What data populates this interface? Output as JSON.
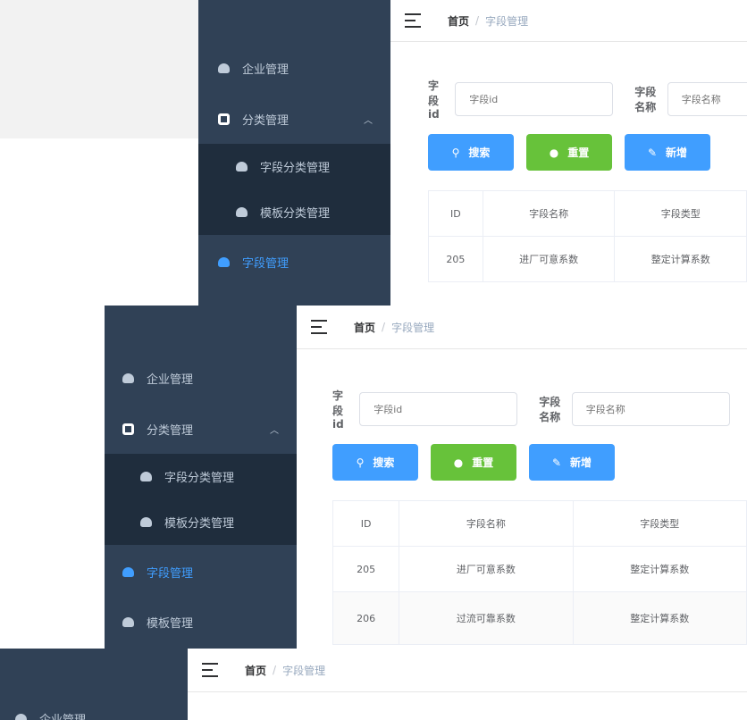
{
  "sidebar": {
    "items": [
      {
        "label": "企业管理",
        "icon": "cloud-icon"
      },
      {
        "label": "分类管理",
        "icon": "square-ring-icon",
        "expanded": true,
        "children": [
          {
            "label": "字段分类管理",
            "icon": "cloud-icon"
          },
          {
            "label": "模板分类管理",
            "icon": "cloud-icon"
          }
        ]
      },
      {
        "label": "字段管理",
        "icon": "cloud-icon",
        "active": true
      },
      {
        "label": "模板管理",
        "icon": "cloud-icon"
      }
    ],
    "bottom_label": "企业管理"
  },
  "breadcrumb": {
    "home": "首页",
    "separator": "/",
    "current": "字段管理"
  },
  "search": {
    "id_label": "字段id",
    "id_placeholder": "字段id",
    "name_label": "字段名称",
    "name_placeholder": "字段名称"
  },
  "buttons": {
    "search": "搜索",
    "reset": "重置",
    "add": "新增"
  },
  "table": {
    "columns": [
      "ID",
      "字段名称",
      "字段类型"
    ],
    "rows": [
      [
        "205",
        "进厂可意系数",
        "整定计算系数"
      ],
      [
        "206",
        "过流可靠系数",
        "整定计算系数"
      ]
    ]
  },
  "colors": {
    "sidebar_bg": "#304156",
    "submenu_bg": "#1f2d3d",
    "primary": "#409eff",
    "success": "#67c23a"
  }
}
